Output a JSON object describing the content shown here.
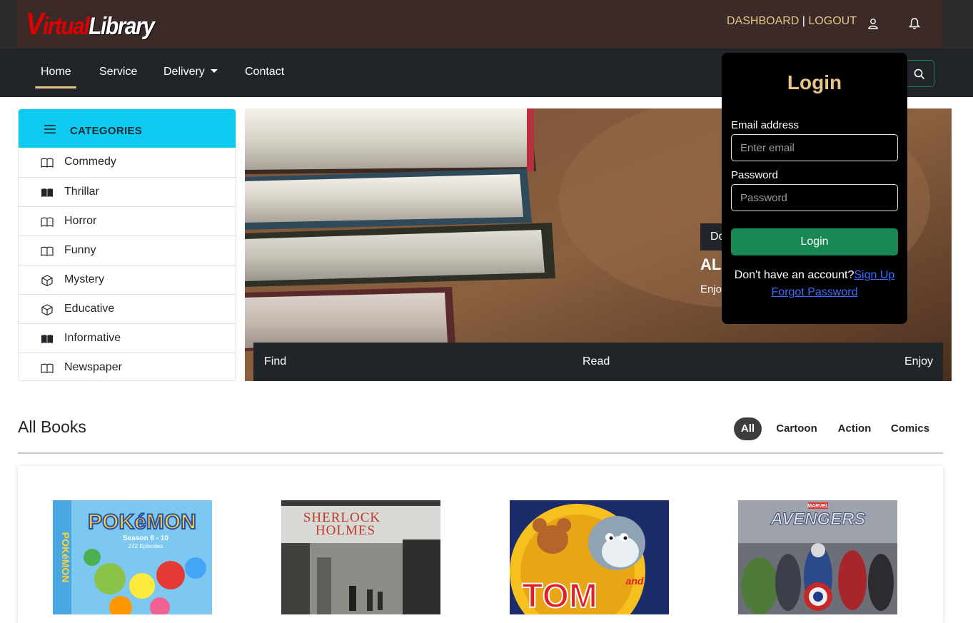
{
  "header": {
    "logo_v": "V",
    "logo_w1": "irtual",
    "logo_w2": "Library",
    "dashboard": "DASHBOARD",
    "separator": " | ",
    "logout": "LOGOUT"
  },
  "nav": {
    "items": [
      "Home",
      "Service",
      "Delivery",
      "Contact"
    ],
    "active": "Home"
  },
  "categories": {
    "title": "CATEGORIES",
    "items": [
      {
        "label": "Commedy",
        "icon": "book-open-icon"
      },
      {
        "label": "Thrillar",
        "icon": "book-filled-icon"
      },
      {
        "label": "Horror",
        "icon": "book-open-icon"
      },
      {
        "label": "Funny",
        "icon": "book-open-icon"
      },
      {
        "label": "Mystery",
        "icon": "box-icon"
      },
      {
        "label": "Educative",
        "icon": "box-icon"
      },
      {
        "label": "Informative",
        "icon": "book-filled-icon"
      },
      {
        "label": "Newspaper",
        "icon": "book-open-icon"
      }
    ]
  },
  "hero": {
    "button_label": "Do",
    "title": "AL",
    "subtitle": "Enjo",
    "bar": [
      "Find",
      "Read",
      "Enjoy"
    ]
  },
  "login": {
    "title": "Login",
    "email_label": "Email address",
    "email_placeholder": "Enter email",
    "password_label": "Password",
    "password_placeholder": "Password",
    "button": "Login",
    "no_account": "Don't have an account?",
    "signup": "Sign Up",
    "forgot": "Forgot Password"
  },
  "books": {
    "title": "All Books",
    "filters": [
      "All",
      "Cartoon",
      "Action",
      "Comics"
    ],
    "active_filter": "All",
    "covers": [
      "pokemon-cover",
      "sherlock-holmes-cover",
      "tom-and-jerry-cover",
      "avengers-cover"
    ],
    "cover_texts": {
      "pokemon": "POKéMON",
      "pokemon_season": "Season 6 - 10",
      "pokemon_episodes": "242 Episodes",
      "sherlock_1": "SHERLOCK",
      "sherlock_2": "HOLMES",
      "tom": "TOM",
      "and": "and",
      "marvel": "MARVEL",
      "avengers": "AVENGERS"
    }
  },
  "colors": {
    "accent_gold": "#e7c58a",
    "categories_header": "#0dcaf0",
    "login_button": "#198754",
    "navbar": "#212529"
  }
}
